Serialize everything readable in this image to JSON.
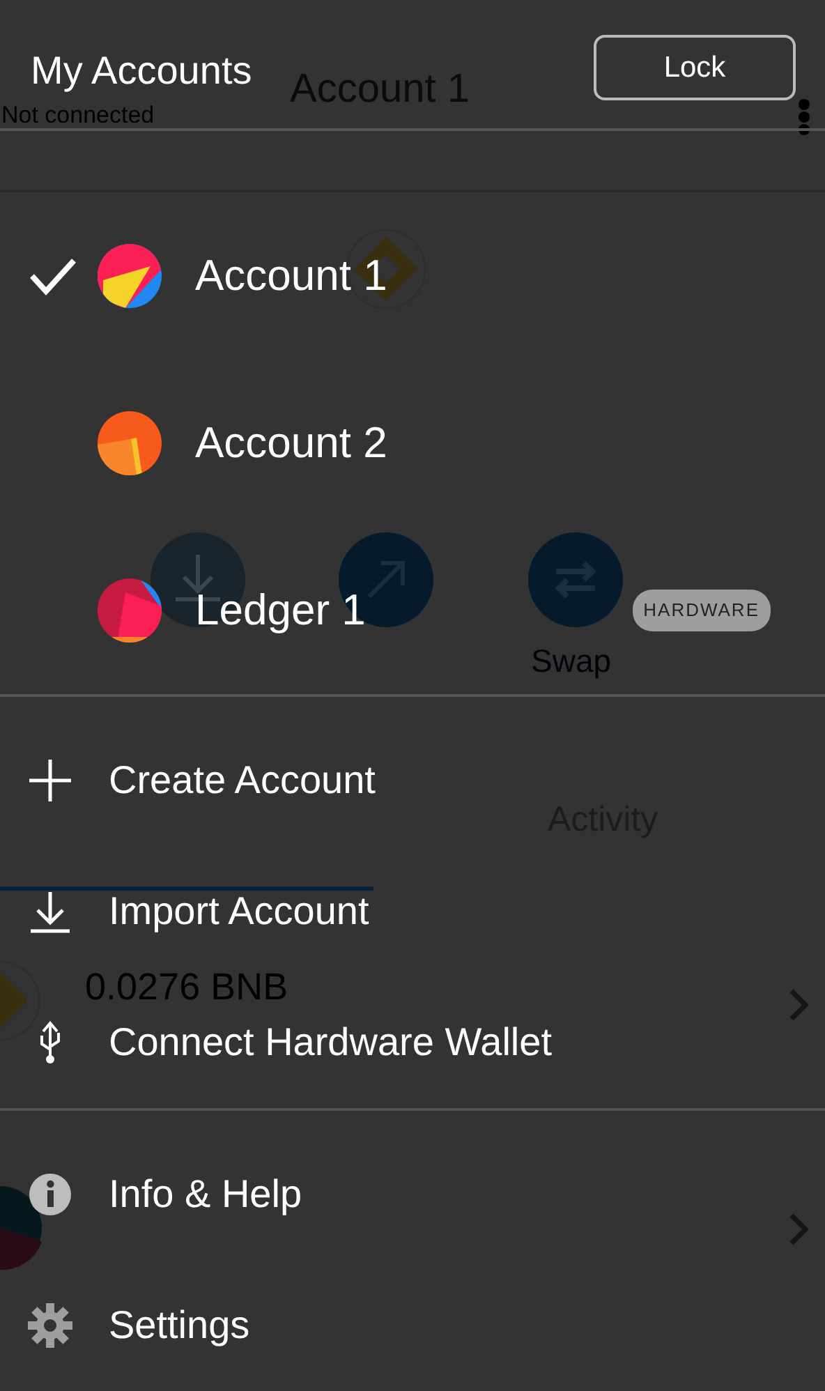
{
  "background_page": {
    "account_name": "Account 1",
    "connection_status": "Not connected",
    "swap_label": "Swap",
    "activity_tab": "Activity",
    "balance": "0.0276 BNB"
  },
  "accounts_menu": {
    "title": "My Accounts",
    "lock_button": "Lock",
    "accounts": [
      {
        "name": "Account 1",
        "selected": true,
        "color": "#fa1f55"
      },
      {
        "name": "Account 2",
        "selected": false,
        "color": "#f85a1c"
      },
      {
        "name": "Ledger 1",
        "selected": false,
        "color": "#c81b41",
        "badge": "HARDWARE"
      }
    ],
    "actions": [
      {
        "label": "Create Account",
        "kind": "plus"
      },
      {
        "label": "Import Account",
        "kind": "import"
      },
      {
        "label": "Connect Hardware Wallet",
        "kind": "usb"
      }
    ],
    "footer_actions": [
      {
        "label": "Info & Help",
        "kind": "info"
      },
      {
        "label": "Settings",
        "kind": "gear"
      }
    ]
  }
}
